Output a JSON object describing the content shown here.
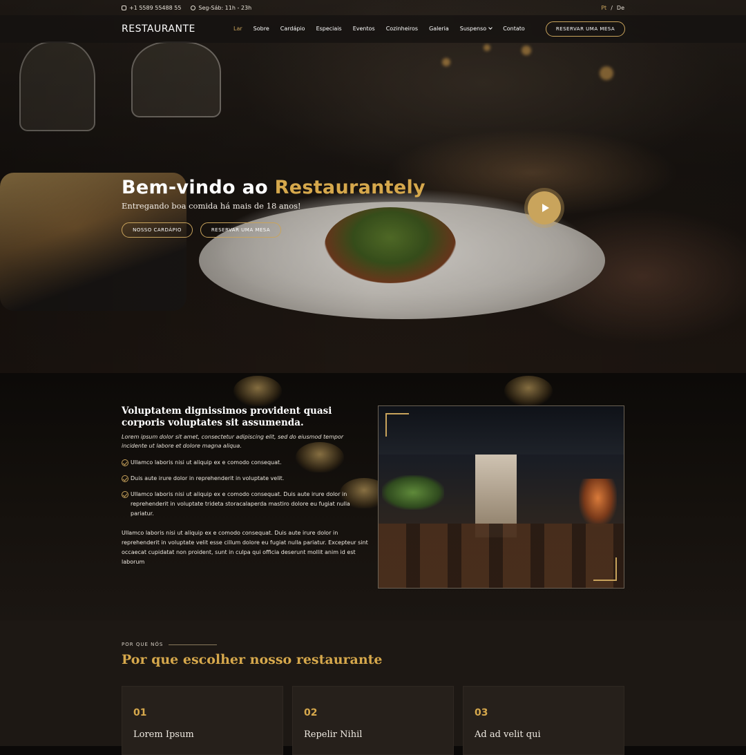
{
  "topbar": {
    "phone": "+1 5589 55488 55",
    "hours": "Seg-Sáb: 11h - 23h",
    "languages": [
      "Pt",
      "/",
      "De"
    ]
  },
  "nav": {
    "logo": "RESTAURANTE",
    "items": [
      "Lar",
      "Sobre",
      "Cardápio",
      "Especiais",
      "Eventos",
      "Cozinheiros",
      "Galeria",
      "Suspenso",
      "Contato"
    ],
    "cta": "RESERVAR UMA MESA"
  },
  "hero": {
    "title_prefix": "Bem-vindo ao ",
    "title_brand": "Restaurantely",
    "subtitle": "Entregando boa comida há mais de 18 anos!",
    "btn_menu": "NOSSO CARDÁPIO",
    "btn_book": "RESERVAR UMA MESA"
  },
  "about": {
    "title": "Voluptatem dignissimos provident quasi corporis voluptates sit assumenda.",
    "lead": "Lorem ipsum dolor sit amet, consectetur adipiscing elit, sed do eiusmod tempor incidente ut labore et dolore magna aliqua.",
    "bullets": [
      "Ullamco laboris nisi ut aliquip ex e comodo consequat.",
      "Duis aute irure dolor in reprehenderit in voluptate velit.",
      "Ullamco laboris nisi ut aliquip ex e comodo consequat. Duis aute irure dolor in reprehenderit in voluptate trideta storacalaperda mastiro dolore eu fugiat nulla pariatur."
    ],
    "body": "Ullamco laboris nisi ut aliquip ex e comodo consequat. Duis aute irure dolor in reprehenderit in voluptate velit esse cillum dolore eu fugiat nulla pariatur. Excepteur sint occaecat cupidatat non proident, sunt in culpa qui officia deserunt mollit anim id est laborum"
  },
  "why": {
    "eyebrow": "POR QUE NÓS",
    "title": "Por que escolher nosso restaurante",
    "cards": [
      {
        "num": "01",
        "title": "Lorem Ipsum"
      },
      {
        "num": "02",
        "title": "Repelir Nihil"
      },
      {
        "num": "03",
        "title": "Ad ad velit qui"
      }
    ]
  },
  "colors": {
    "accent": "#c9a45c",
    "brand_gold": "#d6a84c",
    "background": "#0b0908"
  },
  "icons": [
    "phone-icon",
    "clock-icon",
    "chevron-down-icon",
    "play-icon",
    "check-circle-icon"
  ]
}
